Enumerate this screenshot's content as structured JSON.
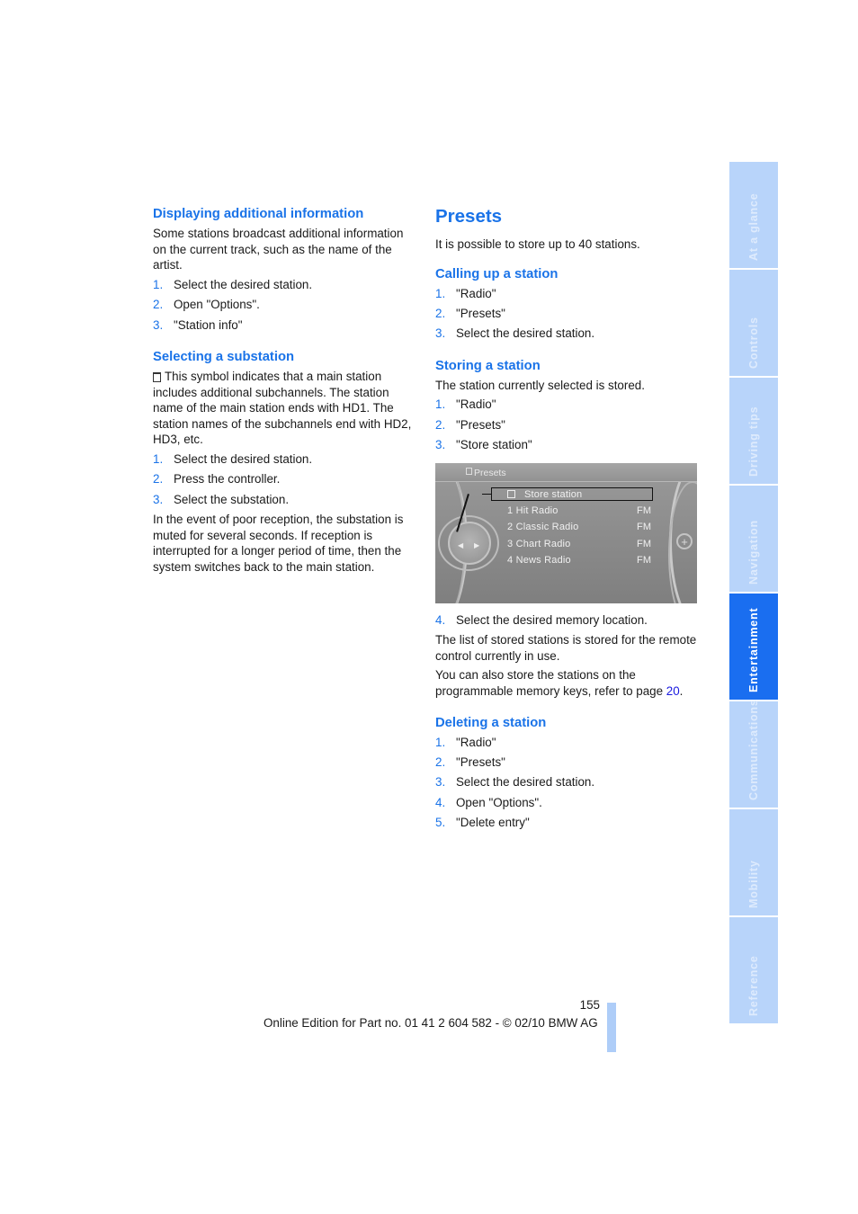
{
  "left_column": {
    "sections": [
      {
        "heading": "Displaying additional information",
        "intro": "Some stations broadcast additional information on the current track, such as the name of the artist.",
        "steps": [
          {
            "num": "1.",
            "text": "Select the desired station."
          },
          {
            "num": "2.",
            "text": "Open \"Options\"."
          },
          {
            "num": "3.",
            "text": "\"Station info\""
          }
        ]
      },
      {
        "heading": "Selecting a substation",
        "intro_symbol": "hd-subchannel-symbol",
        "intro": "This symbol indicates that a main station includes additional subchannels. The station name of the main station ends with HD1. The station names of the subchannels end with HD2, HD3, etc.",
        "steps": [
          {
            "num": "1.",
            "text": "Select the desired station."
          },
          {
            "num": "2.",
            "text": "Press the controller."
          },
          {
            "num": "3.",
            "text": "Select the substation."
          }
        ],
        "note": "In the event of poor reception, the substation is muted for several seconds. If reception is interrupted for a longer period of time, then the system switches back to the main station."
      }
    ]
  },
  "right_column": {
    "title": "Presets",
    "intro": "It is possible to store up to 40 stations.",
    "calling": {
      "heading": "Calling up a station",
      "steps": [
        {
          "num": "1.",
          "text": "\"Radio\""
        },
        {
          "num": "2.",
          "text": "\"Presets\""
        },
        {
          "num": "3.",
          "text": "Select the desired station."
        }
      ]
    },
    "storing": {
      "heading": "Storing a station",
      "intro": "The station currently selected is stored.",
      "steps": [
        {
          "num": "1.",
          "text": "\"Radio\""
        },
        {
          "num": "2.",
          "text": "\"Presets\""
        },
        {
          "num": "3.",
          "text": "\"Store station\""
        }
      ],
      "screen": {
        "title": "Presets",
        "highlighted": "Store station",
        "stations": [
          {
            "label": "1  Hit Radio",
            "band": "FM"
          },
          {
            "label": "2  Classic Radio",
            "band": "FM"
          },
          {
            "label": "3  Chart Radio",
            "band": "FM"
          },
          {
            "label": "4  News Radio",
            "band": "FM"
          }
        ]
      },
      "steps_after": [
        {
          "num": "4.",
          "text": "Select the desired memory location."
        }
      ],
      "note1": "The list of stored stations is stored for the remote control currently in use.",
      "note2_before": "You can also store the stations on the programmable memory keys, refer to page ",
      "note2_link": "20",
      "note2_after": "."
    },
    "deleting": {
      "heading": "Deleting a station",
      "steps": [
        {
          "num": "1.",
          "text": "\"Radio\""
        },
        {
          "num": "2.",
          "text": "\"Presets\""
        },
        {
          "num": "3.",
          "text": "Select the desired station."
        },
        {
          "num": "4.",
          "text": "Open \"Options\"."
        },
        {
          "num": "5.",
          "text": "\"Delete entry\""
        }
      ]
    }
  },
  "footer": {
    "page_number": "155",
    "edition": "Online Edition for Part no. 01 41 2 604 582 - © 02/10 BMW AG"
  },
  "side_tabs": [
    {
      "label": "At a glance",
      "active": false
    },
    {
      "label": "Controls",
      "active": false
    },
    {
      "label": "Driving tips",
      "active": false
    },
    {
      "label": "Navigation",
      "active": false
    },
    {
      "label": "Entertainment",
      "active": true
    },
    {
      "label": "Communications",
      "active": false
    },
    {
      "label": "Mobility",
      "active": false
    },
    {
      "label": "Reference",
      "active": false
    }
  ],
  "colors": {
    "accent": "#1a73e8",
    "tab_inactive": "#b8d4fa",
    "tab_active": "#1a6ef0",
    "link": "#1a1ae0"
  }
}
